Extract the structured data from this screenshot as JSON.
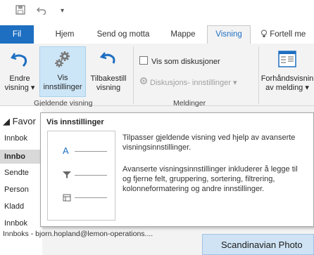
{
  "qat": {
    "save_icon": "save-icon",
    "undo_icon": "undo-icon",
    "customize_icon": "chevron-down-icon"
  },
  "tabs": [
    {
      "label": "Fil"
    },
    {
      "label": "Hjem"
    },
    {
      "label": "Send og motta"
    },
    {
      "label": "Mappe"
    },
    {
      "label": "Visning"
    },
    {
      "label": "Fortell me"
    }
  ],
  "ribbon": {
    "change_view": {
      "line1": "Endre",
      "line2": "visning ▾"
    },
    "view_settings": {
      "line1": "Vis",
      "line2": "innstillinger"
    },
    "reset_view": {
      "line1": "Tilbakestill",
      "line2": "visning"
    },
    "group_current_view": "Gjeldende visning",
    "show_as_conversations": "Vis som diskusjoner",
    "conversation_settings": "Diskusjons- innstillinger ▾",
    "group_messages": "Meldinger",
    "message_preview": {
      "line1": "Forhåndsvisnin",
      "line2": "av melding ▾"
    }
  },
  "nav": {
    "favorites": "◢ Favor",
    "items": [
      "Innbok",
      "Innbo",
      "Sendte",
      "Person",
      "Kladd",
      "Innbok"
    ]
  },
  "tooltip": {
    "title": "Vis innstillinger",
    "para1": "Tilpasser gjeldende visning ved hjelp av avanserte visningsinnstillinger.",
    "para2": "Avanserte visningsinnstillinger inkluderer å legge til og fjerne felt, gruppering, sortering, filtrering, kolonneformatering og andre innstillinger.",
    "art_letter": "A"
  },
  "status": {
    "mailbox": "Innboks - bjorn.hopland@lemon-operations...."
  },
  "preview_item": {
    "label": "Scandinavian Photo"
  },
  "colors": {
    "accent": "#1e6fc2",
    "hover": "#cde6f7"
  }
}
